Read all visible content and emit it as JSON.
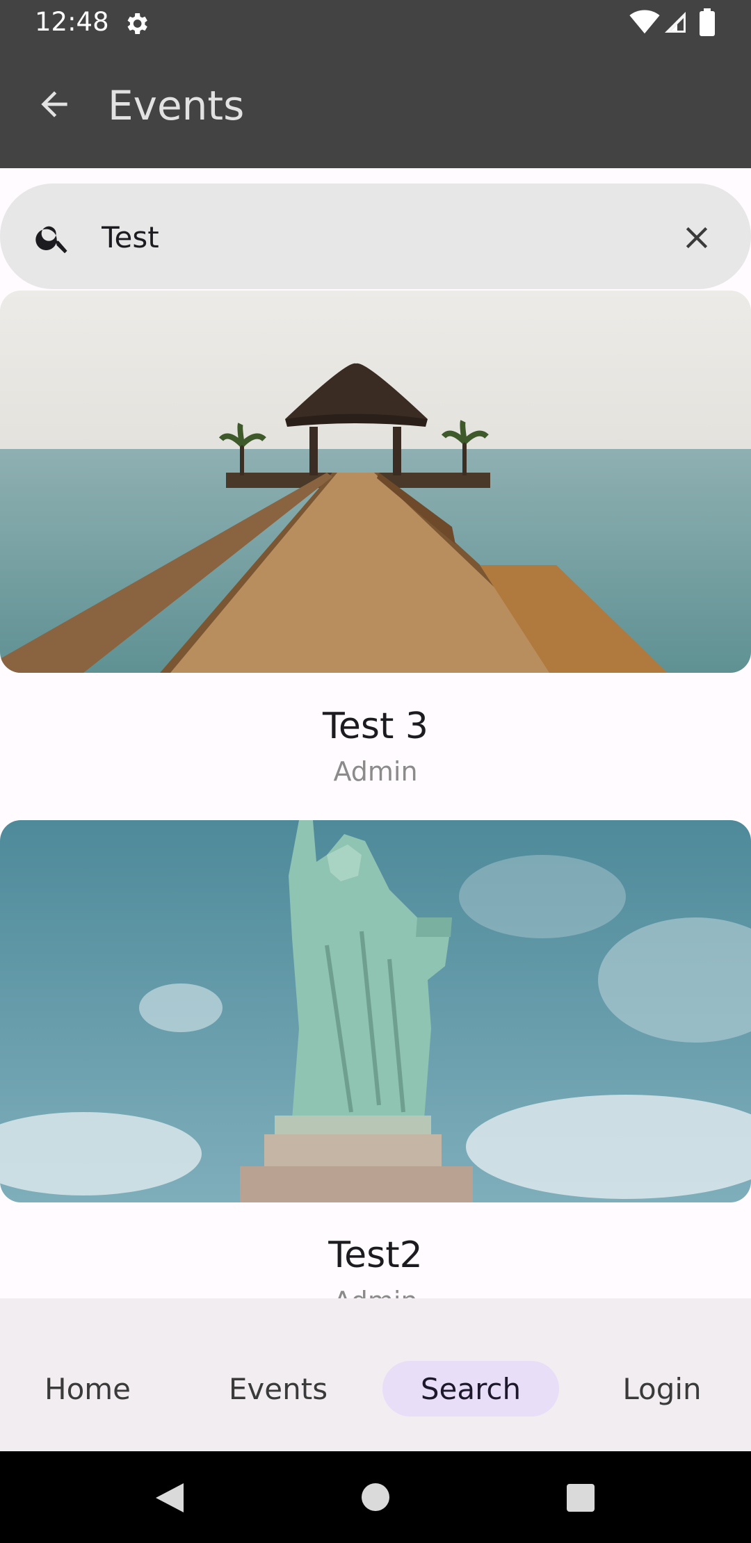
{
  "status_bar": {
    "time": "12:48"
  },
  "app_bar": {
    "title": "Events"
  },
  "search": {
    "value": "Test",
    "placeholder": "Search"
  },
  "results": [
    {
      "title": "Test 3",
      "author": "Admin",
      "image": "pier-photo"
    },
    {
      "title": "Test2",
      "author": "Admin",
      "image": "statue-of-liberty-photo"
    }
  ],
  "bottom_nav": {
    "items": [
      {
        "label": "Home"
      },
      {
        "label": "Events"
      },
      {
        "label": "Search",
        "active": true
      },
      {
        "label": "Login"
      }
    ]
  },
  "colors": {
    "app_bar": "#434343",
    "nav_active": "#E8DEF8",
    "search_bg": "#E7E7E7"
  }
}
